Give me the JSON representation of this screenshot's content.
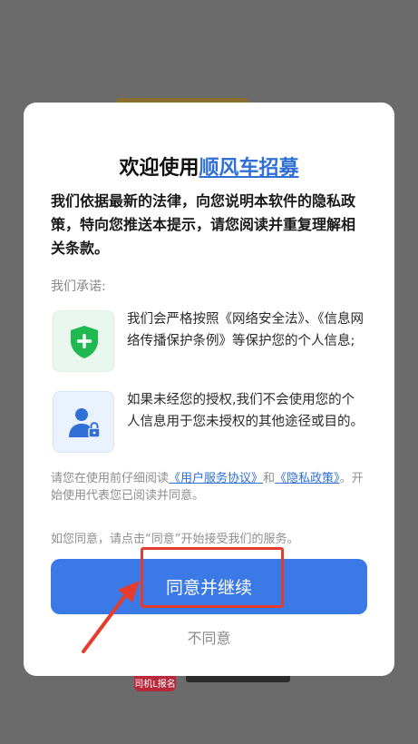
{
  "background": {
    "bottom_icon_label": "司机L报名"
  },
  "dialog": {
    "title_prefix": "欢迎使用",
    "title_brand": "顺风车招募",
    "intro": "我们依据最新的法律，向您说明本软件的隐私政策，特向您推送本提示，请您阅读并重复理解相关条款。",
    "promise_label": "我们承诺:",
    "features": [
      {
        "icon": "shield-plus-icon",
        "text": "我们会严格按照《网络安全法》、《信息网络传播保护条例》等保护您的个人信息;"
      },
      {
        "icon": "user-lock-icon",
        "text": "如果未经您的授权,我们不会使用您的个人信息用于您未授权的其他途径或目的。"
      }
    ],
    "policy": {
      "before": "请您在使用前仔细阅读",
      "link_service": "《用户服务协议》",
      "and": "和",
      "link_privacy": "《隐私政策》",
      "after": "。开始使用代表您已阅读并同意。"
    },
    "consent_text": "如您同意，请点击“同意”开始接受我们的服务。",
    "agree_label": "同意并继续",
    "disagree_label": "不同意"
  },
  "colors": {
    "accent": "#3b7ae6",
    "link": "#2f6fd6",
    "annotation": "#e43d2f",
    "shield": "#1fb851"
  }
}
